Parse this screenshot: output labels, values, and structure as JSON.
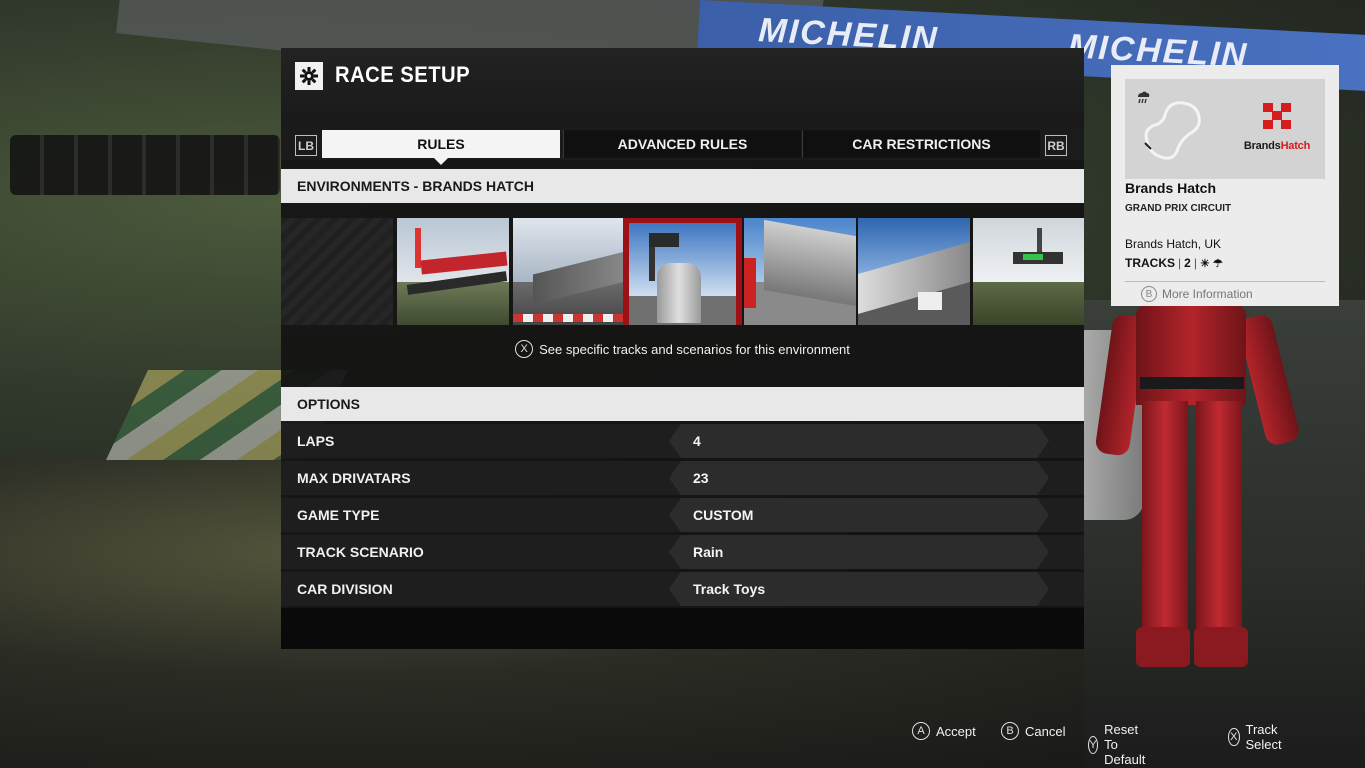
{
  "background": {
    "banner_text": "MICHELIN"
  },
  "panel": {
    "title": "RACE SETUP",
    "title_icon": "gear-icon",
    "lb_label": "LB",
    "rb_label": "RB",
    "tabs": [
      {
        "label": "RULES",
        "active": true
      },
      {
        "label": "ADVANCED RULES",
        "active": false
      },
      {
        "label": "CAR RESTRICTIONS",
        "active": false
      }
    ]
  },
  "environments": {
    "header": "ENVIRONMENTS - BRANDS HATCH",
    "selected_index": 2,
    "thumbnail_count": 6,
    "hint_button": "X",
    "hint_text": "See specific tracks and scenarios for this environment"
  },
  "options": {
    "header": "OPTIONS",
    "rows": [
      {
        "label": "LAPS",
        "value": "4"
      },
      {
        "label": "MAX DRIVATARS",
        "value": "23"
      },
      {
        "label": "GAME TYPE",
        "value": "CUSTOM"
      },
      {
        "label": "TRACK SCENARIO",
        "value": "Rain"
      },
      {
        "label": "CAR DIVISION",
        "value": "Track Toys"
      }
    ]
  },
  "track_card": {
    "name": "Brands Hatch",
    "type": "GRAND PRIX CIRCUIT",
    "location": "Brands Hatch, UK",
    "tracks_label": "TRACKS",
    "tracks_count": "2",
    "logo_text_1": "Brands",
    "logo_text_2": "Hatch",
    "more_button": "B",
    "more_label": "More Information",
    "weather_icons": [
      "sun-icon",
      "rain-icon"
    ]
  },
  "prompts": [
    {
      "button": "A",
      "label": "Accept"
    },
    {
      "button": "B",
      "label": "Cancel"
    },
    {
      "button": "Y",
      "label": "Reset To Default"
    },
    {
      "button": "X",
      "label": "Track Select"
    }
  ],
  "colors": {
    "accent_red": "#9c1016",
    "active_tab": "#f4f4f4",
    "panel_bg": "#121212"
  }
}
